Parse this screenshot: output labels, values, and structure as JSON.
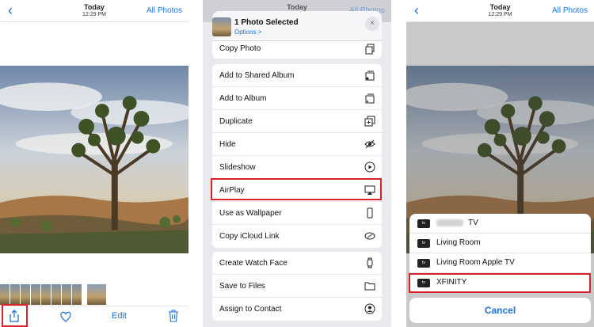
{
  "nav": {
    "back": "‹",
    "title": "Today",
    "time": "12:29 PM",
    "all_photos": "All Photos"
  },
  "bottom": {
    "edit": "Edit"
  },
  "sheet": {
    "title": "1 Photo Selected",
    "options": "Options >",
    "close": "×",
    "top_item": "Copy Photo",
    "group1": [
      {
        "label": "Add to Shared Album",
        "icon": "shared-album-icon"
      },
      {
        "label": "Add to Album",
        "icon": "album-icon"
      },
      {
        "label": "Duplicate",
        "icon": "duplicate-icon"
      },
      {
        "label": "Hide",
        "icon": "hide-icon"
      },
      {
        "label": "Slideshow",
        "icon": "play-icon"
      },
      {
        "label": "AirPlay",
        "icon": "airplay-icon"
      },
      {
        "label": "Use as Wallpaper",
        "icon": "phone-icon"
      },
      {
        "label": "Copy iCloud Link",
        "icon": "link-icon"
      }
    ],
    "group2": [
      {
        "label": "Create Watch Face",
        "icon": "watch-icon"
      },
      {
        "label": "Save to Files",
        "icon": "folder-icon"
      },
      {
        "label": "Assign to Contact",
        "icon": "contact-icon"
      }
    ]
  },
  "airplay": {
    "devices": [
      {
        "label": "TV",
        "redacted": true
      },
      {
        "label": "Living Room"
      },
      {
        "label": "Living Room Apple TV"
      },
      {
        "label": "XFINITY"
      }
    ],
    "badge": "tv",
    "cancel": "Cancel"
  },
  "colors": {
    "accent": "#1a73e8",
    "highlight": "#d8232a"
  }
}
